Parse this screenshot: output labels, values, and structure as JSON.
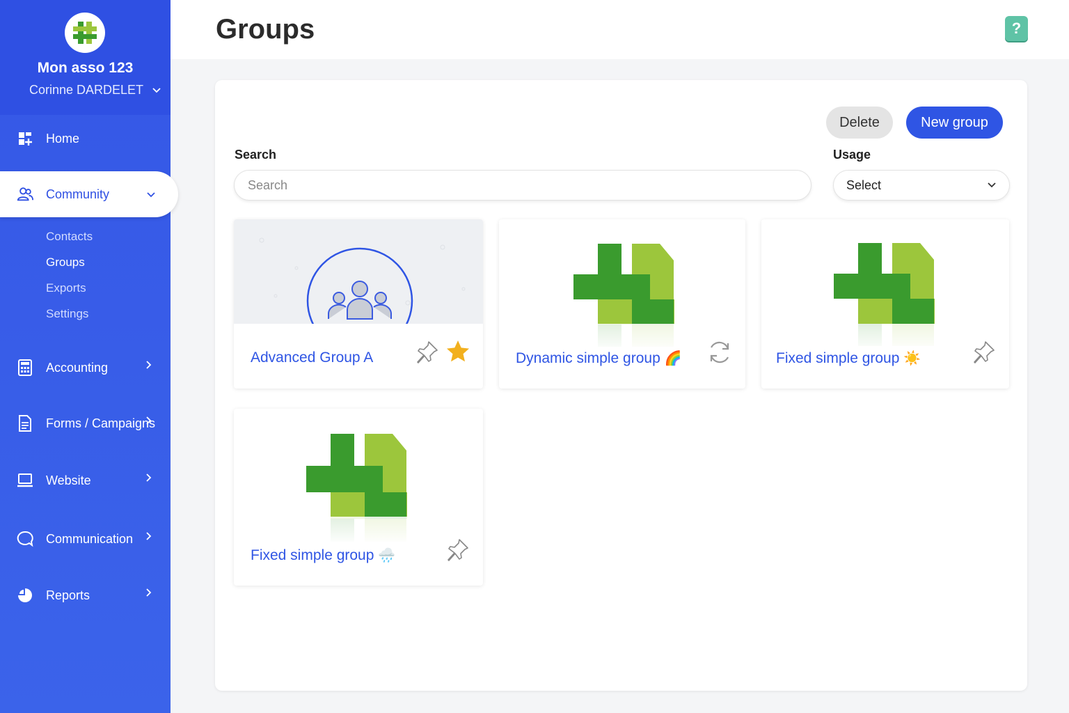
{
  "org": {
    "name": "Mon asso 123",
    "user": "Corinne DARDELET"
  },
  "nav": {
    "home": "Home",
    "community": "Community",
    "community_sub": [
      "Contacts",
      "Groups",
      "Exports",
      "Settings"
    ],
    "accounting": "Accounting",
    "forms": "Forms / Campaigns",
    "website": "Website",
    "communication": "Communication",
    "reports": "Reports"
  },
  "page": {
    "title": "Groups",
    "help": "?"
  },
  "actions": {
    "delete": "Delete",
    "new_group": "New group"
  },
  "filters": {
    "search_label": "Search",
    "search_placeholder": "Search",
    "usage_label": "Usage",
    "usage_value": "Select"
  },
  "groups": [
    {
      "name": "Advanced Group A",
      "emoji": "",
      "status": "pinnable, starred"
    },
    {
      "name": "Dynamic simple group",
      "emoji": "🌈",
      "status": "dynamic"
    },
    {
      "name": "Fixed simple group",
      "emoji": "☀️",
      "status": "pinnable"
    },
    {
      "name": "Fixed simple group",
      "emoji": "🌧️",
      "status": "pinnable"
    }
  ],
  "colors": {
    "brand_blue": "#2f55e4",
    "sidebar": "#3557e6",
    "logo_green_dark": "#3a9b2e",
    "logo_green_light": "#9cc63c",
    "star": "#f2b01e",
    "help": "#5fc3a6"
  }
}
